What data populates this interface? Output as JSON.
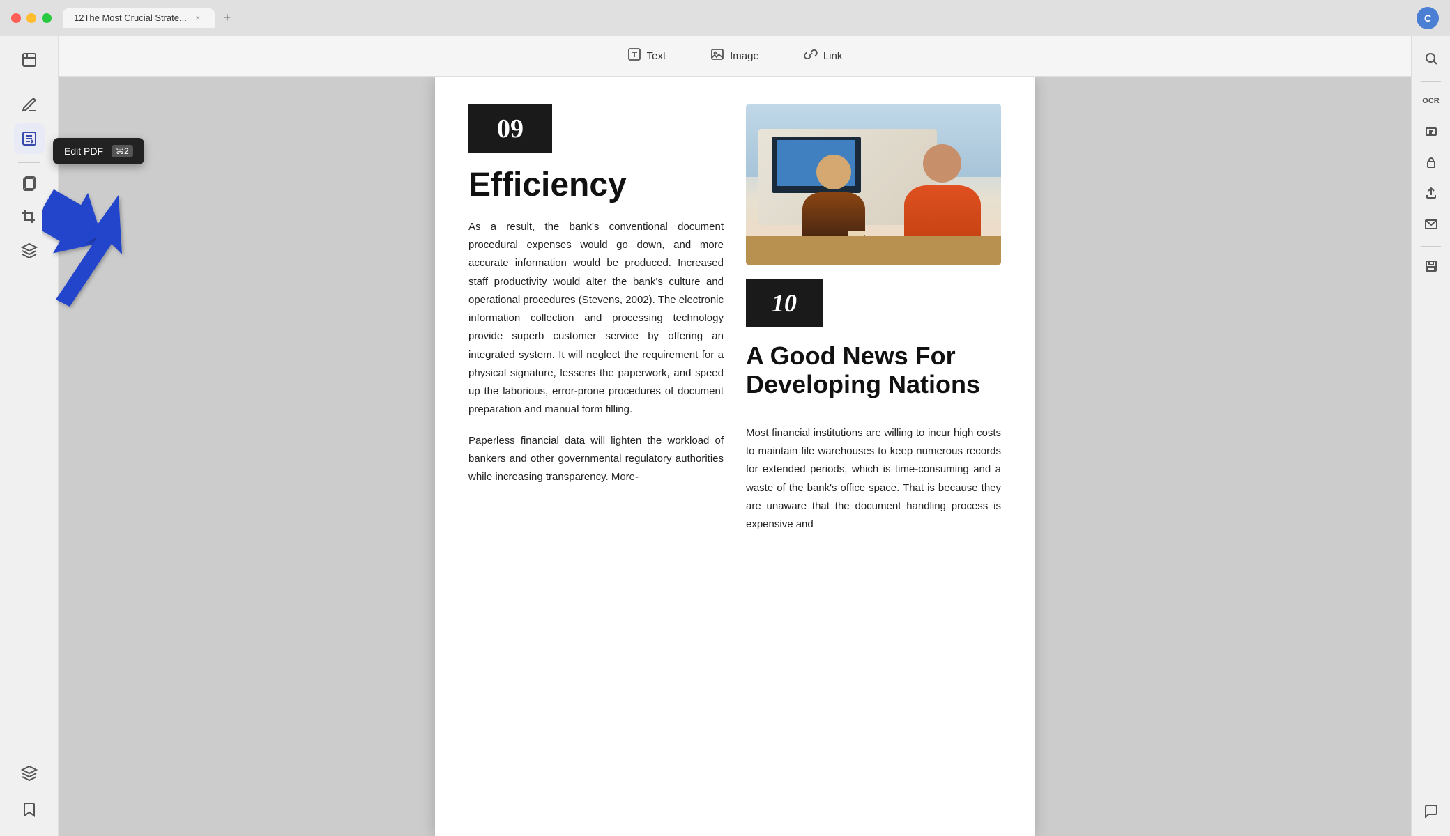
{
  "titlebar": {
    "tab_title": "12The Most Crucial Strate...",
    "add_tab_label": "+",
    "user_initial": "C"
  },
  "toolbar": {
    "text_label": "Text",
    "image_label": "Image",
    "link_label": "Link"
  },
  "tooltip": {
    "label": "Edit PDF",
    "shortcut": "⌘2"
  },
  "sidebar": {
    "icons": [
      {
        "name": "page-view-icon",
        "symbol": "☰"
      },
      {
        "name": "edit-pdf-icon",
        "symbol": "✏️"
      },
      {
        "name": "annotate-icon",
        "symbol": "🖊"
      },
      {
        "name": "template-icon",
        "symbol": "⊞"
      },
      {
        "name": "crop-icon",
        "symbol": "⊡"
      },
      {
        "name": "stack-icon",
        "symbol": "⧉"
      },
      {
        "name": "bookmark-icon",
        "symbol": "🔖"
      }
    ]
  },
  "right_toolbar": {
    "icons": [
      {
        "name": "search-icon",
        "symbol": "🔍"
      },
      {
        "name": "ocr-icon",
        "label": "OCR"
      },
      {
        "name": "redact-icon",
        "symbol": "⊟"
      },
      {
        "name": "protect-icon",
        "symbol": "🔒"
      },
      {
        "name": "share-icon",
        "symbol": "↑"
      },
      {
        "name": "email-icon",
        "symbol": "✉"
      },
      {
        "name": "save-icon",
        "symbol": "💾"
      },
      {
        "name": "chat-icon",
        "symbol": "💬"
      }
    ]
  },
  "pdf": {
    "section09": {
      "number": "09",
      "title": "Efficiency",
      "body_para1": "As a result, the bank's conventional document procedural expenses would go down, and more accurate information would be produced. Increased staff productivity would alter the bank's culture and operational procedures (Stevens, 2002). The electronic information collection and processing technology provide superb customer service by offering an integrated system. It will neglect the requirement for a physical signature, lessens the paperwork, and speed up the laborious, error-prone procedures of document preparation and manual form filling.",
      "body_para2": "Paperless financial data will lighten the workload of bankers and other governmental regulatory authorities while increasing transparency. More-"
    },
    "section10": {
      "number": "10",
      "title": "A Good News For Developing Nations",
      "body_text": "Most financial institutions are willing to incur high costs to maintain file warehouses to keep numerous records for extended periods, which is time-consuming and a waste of the bank's office space. That is because they are unaware that the document handling process is expensive and"
    }
  }
}
